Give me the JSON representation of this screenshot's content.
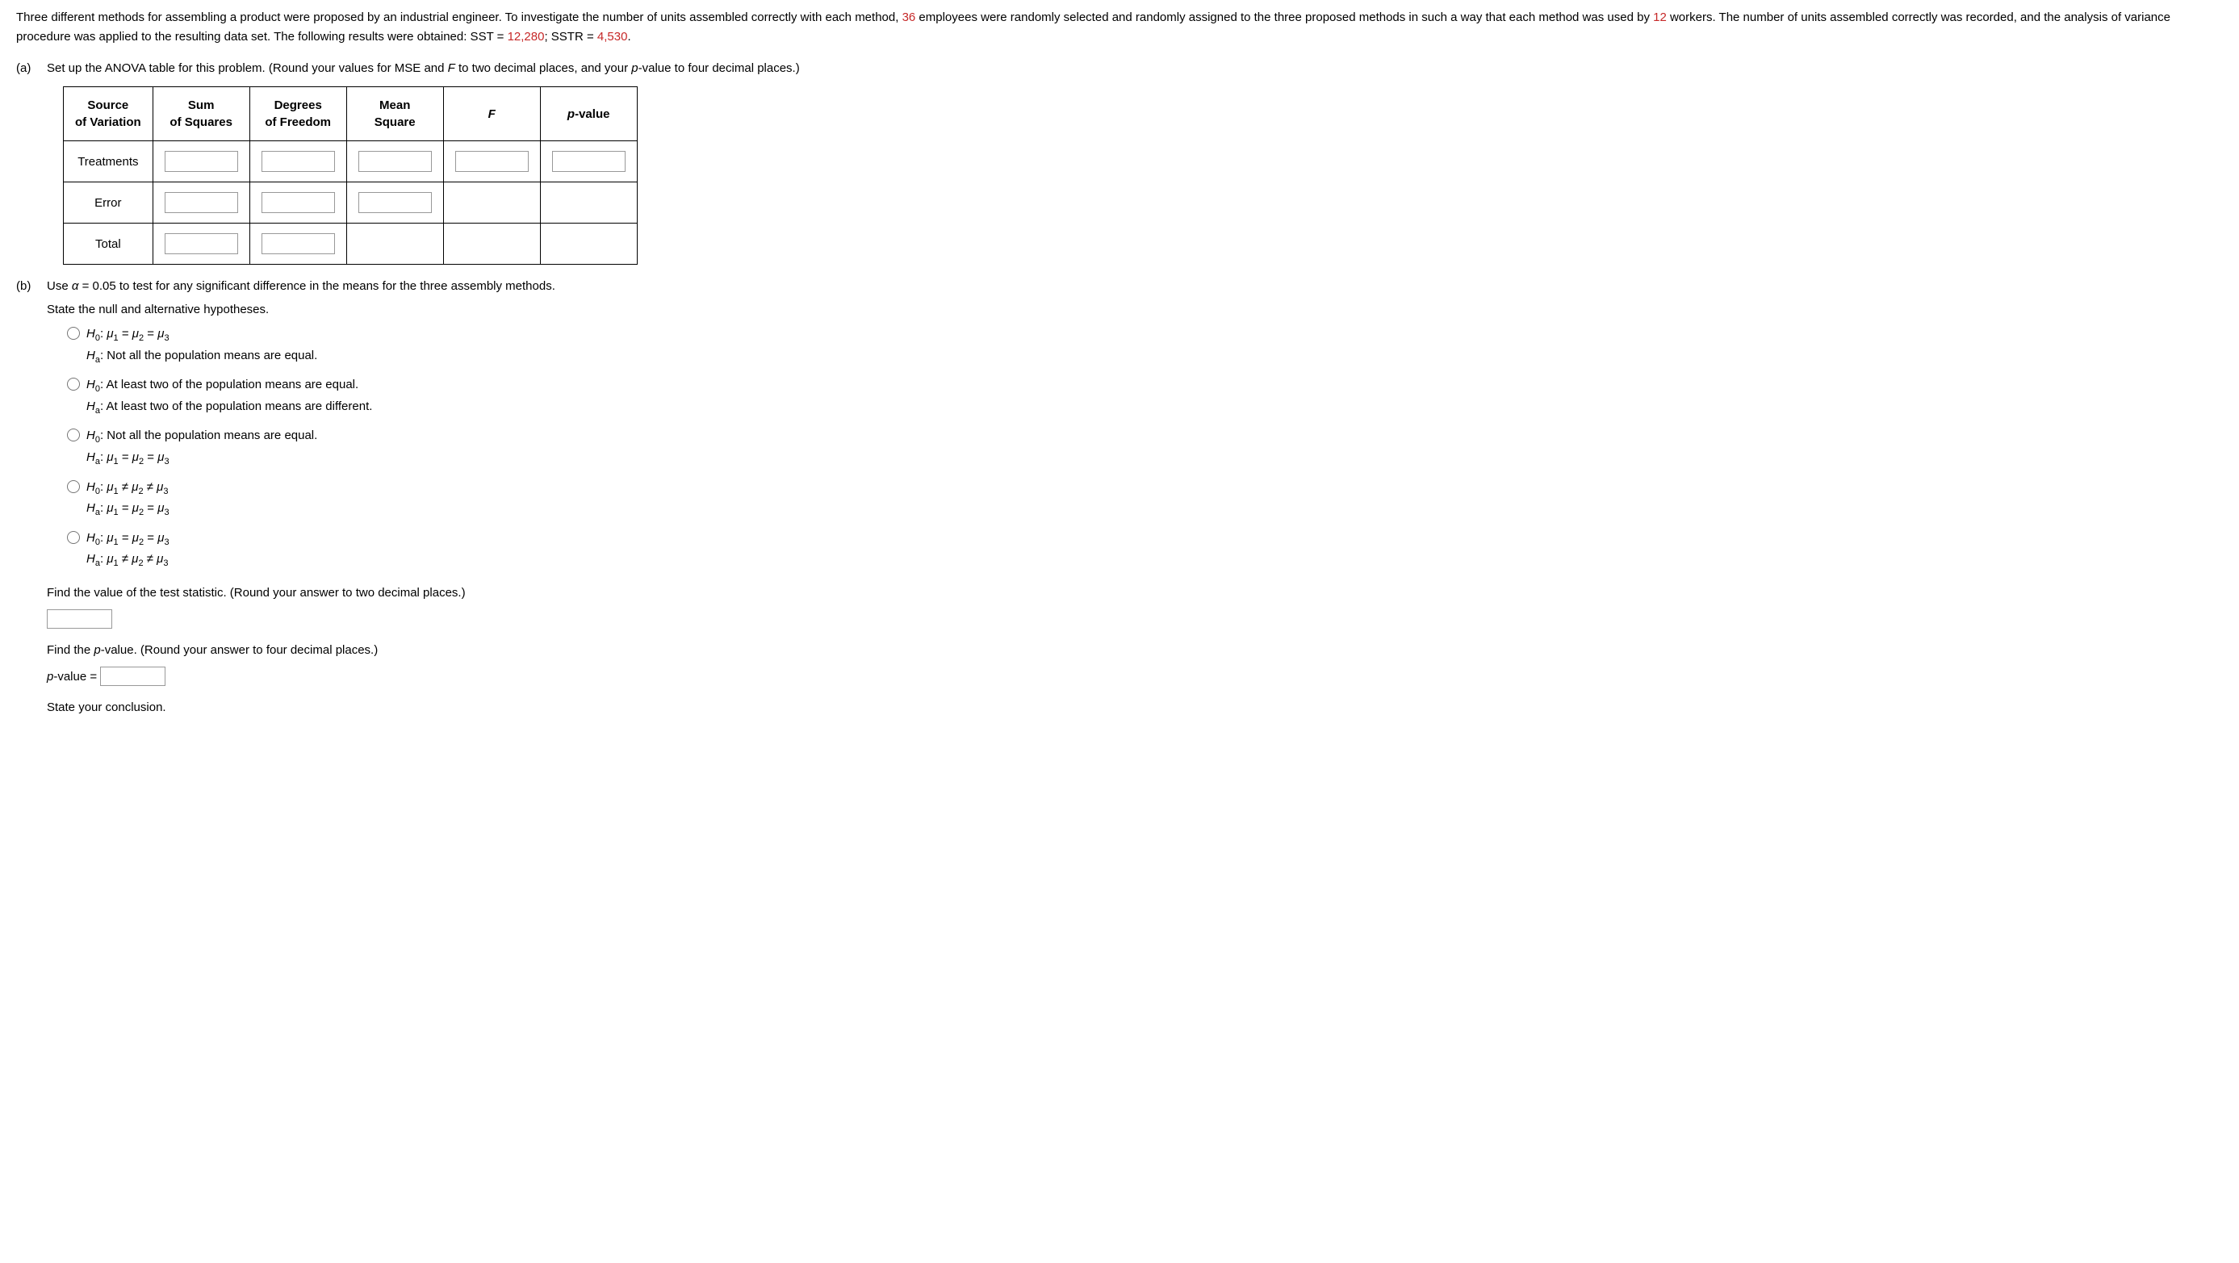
{
  "intro": {
    "t1": "Three different methods for assembling a product were proposed by an industrial engineer. To investigate the number of units assembled correctly with each method, ",
    "n1": "36",
    "t2": " employees were randomly selected and randomly assigned to the three proposed methods in such a way that each method was used by ",
    "n2": "12",
    "t3": " workers. The number of units assembled correctly was recorded, and the analysis of variance procedure was applied to the resulting data set. The following results were obtained: SST = ",
    "n3": "12,280",
    "t4": "; SSTR = ",
    "n4": "4,530",
    "t5": "."
  },
  "partA": {
    "label": "(a)",
    "instruction1": "Set up the ANOVA table for this problem. (Round your values for MSE and ",
    "F": "F",
    "instruction2": " to two decimal places, and your ",
    "p1": "p",
    "instruction3": "-value to four decimal places.)"
  },
  "tableHeaders": {
    "source1": "Source",
    "source2": "of Variation",
    "sum1": "Sum",
    "sum2": "of Squares",
    "deg1": "Degrees",
    "deg2": "of Freedom",
    "mean1": "Mean",
    "mean2": "Square",
    "F": "F",
    "p1": "p",
    "p2": "-value"
  },
  "tableRows": {
    "treatments": "Treatments",
    "error": "Error",
    "total": "Total"
  },
  "partB": {
    "label": "(b)",
    "instruction1": "Use ",
    "alpha": "α",
    "instruction2": " = 0.05 to test for any significant difference in the means for the three assembly methods.",
    "stateHyp": "State the null and alternative hypotheses."
  },
  "hyp": {
    "opt1": {
      "h0a": "H",
      "h0b": "0",
      "h0c": ": ",
      "h0d": "μ",
      "h0e": "1",
      "h0f": " = ",
      "h0g": "μ",
      "h0h": "2",
      "h0i": " = ",
      "h0j": "μ",
      "h0k": "3",
      "haa": "H",
      "hab": "a",
      "hac": ": Not all the population means are equal."
    },
    "opt2": {
      "h0a": "H",
      "h0b": "0",
      "h0c": ": At least two of the population means are equal.",
      "haa": "H",
      "hab": "a",
      "hac": ": At least two of the population means are different."
    },
    "opt3": {
      "h0a": "H",
      "h0b": "0",
      "h0c": ": Not all the population means are equal.",
      "haa": "H",
      "hab": "a",
      "hac": ": ",
      "had": "μ",
      "hae": "1",
      "haf": " = ",
      "hag": "μ",
      "hah": "2",
      "hai": " = ",
      "haj": "μ",
      "hak": "3"
    },
    "opt4": {
      "h0a": "H",
      "h0b": "0",
      "h0c": ": ",
      "h0d": "μ",
      "h0e": "1",
      "h0f": " ≠ ",
      "h0g": "μ",
      "h0h": "2",
      "h0i": " ≠ ",
      "h0j": "μ",
      "h0k": "3",
      "haa": "H",
      "hab": "a",
      "hac": ": ",
      "had": "μ",
      "hae": "1",
      "haf": " = ",
      "hag": "μ",
      "hah": "2",
      "hai": " = ",
      "haj": "μ",
      "hak": "3"
    },
    "opt5": {
      "h0a": "H",
      "h0b": "0",
      "h0c": ": ",
      "h0d": "μ",
      "h0e": "1",
      "h0f": " = ",
      "h0g": "μ",
      "h0h": "2",
      "h0i": " = ",
      "h0j": "μ",
      "h0k": "3",
      "haa": "H",
      "hab": "a",
      "hac": ": ",
      "had": "μ",
      "hae": "1",
      "haf": " ≠ ",
      "hag": "μ",
      "hah": "2",
      "hai": " ≠ ",
      "haj": "μ",
      "hak": "3"
    }
  },
  "testStat": {
    "instr": "Find the value of the test statistic. (Round your answer to two decimal places.)"
  },
  "pValue": {
    "instr1": "Find the ",
    "p": "p",
    "instr2": "-value. (Round your answer to four decimal places.)",
    "label1": "p",
    "label2": "-value ="
  },
  "conclusion": "State your conclusion."
}
